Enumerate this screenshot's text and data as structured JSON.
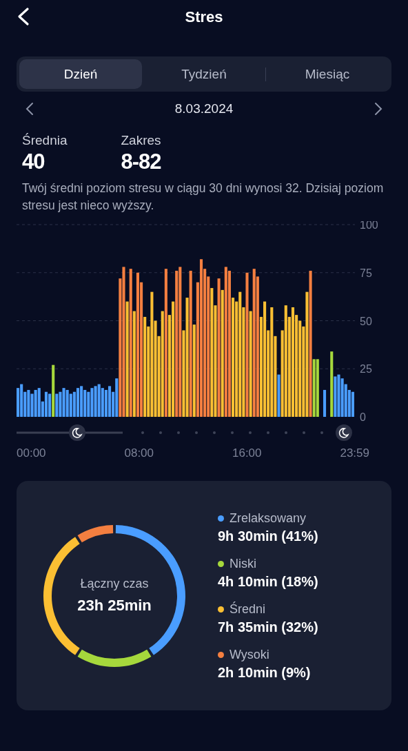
{
  "header": {
    "title": "Stres"
  },
  "tabs": [
    {
      "label": "Dzień",
      "selected": true
    },
    {
      "label": "Tydzień",
      "selected": false
    },
    {
      "label": "Miesiąc",
      "selected": false
    }
  ],
  "date": "8.03.2024",
  "stats": [
    {
      "label": "Średnia",
      "value": "40"
    },
    {
      "label": "Zakres",
      "value": "8-82"
    }
  ],
  "description": "Twój średni poziom stresu w ciągu 30 dni wynosi 32. Dzisiaj poziom stresu jest nieco wyższy.",
  "stress_chart": {
    "time_labels": [
      "00:00",
      "08:00",
      "16:00",
      "23:59"
    ],
    "chart_data": {
      "type": "bar",
      "grid": true,
      "yticks": [
        0,
        25,
        50,
        75,
        100
      ],
      "ylim": [
        0,
        100
      ],
      "values": [
        15,
        17,
        13,
        14,
        12,
        14,
        15,
        8,
        13,
        12,
        27,
        12,
        13,
        15,
        14,
        12,
        13,
        15,
        16,
        14,
        13,
        15,
        16,
        17,
        15,
        14,
        16,
        13,
        20,
        72,
        78,
        60,
        77,
        55,
        75,
        70,
        52,
        47,
        65,
        50,
        42,
        55,
        77,
        53,
        60,
        76,
        78,
        45,
        62,
        76,
        48,
        70,
        82,
        77,
        73,
        67,
        58,
        72,
        66,
        78,
        76,
        62,
        60,
        65,
        57,
        75,
        55,
        77,
        73,
        52,
        60,
        45,
        57,
        42,
        22,
        45,
        58,
        52,
        57,
        53,
        50,
        47,
        65,
        76,
        30,
        30,
        null,
        14,
        null,
        34,
        21,
        22,
        20,
        17,
        14,
        13
      ]
    }
  },
  "summary": {
    "total_label": "Łączny czas",
    "total_value": "23h 25min",
    "chart_data": {
      "type": "donut",
      "values": [
        41,
        18,
        32,
        9
      ]
    },
    "legend": [
      {
        "name": "Zrelaksowany",
        "value": "9h 30min (41%)",
        "color": "#4a9dff"
      },
      {
        "name": "Niski",
        "value": "4h 10min (18%)",
        "color": "#a6d83c"
      },
      {
        "name": "Średni",
        "value": "7h 35min (32%)",
        "color": "#fbbf33"
      },
      {
        "name": "Wysoki",
        "value": "2h 10min (9%)",
        "color": "#f47f40"
      }
    ]
  }
}
